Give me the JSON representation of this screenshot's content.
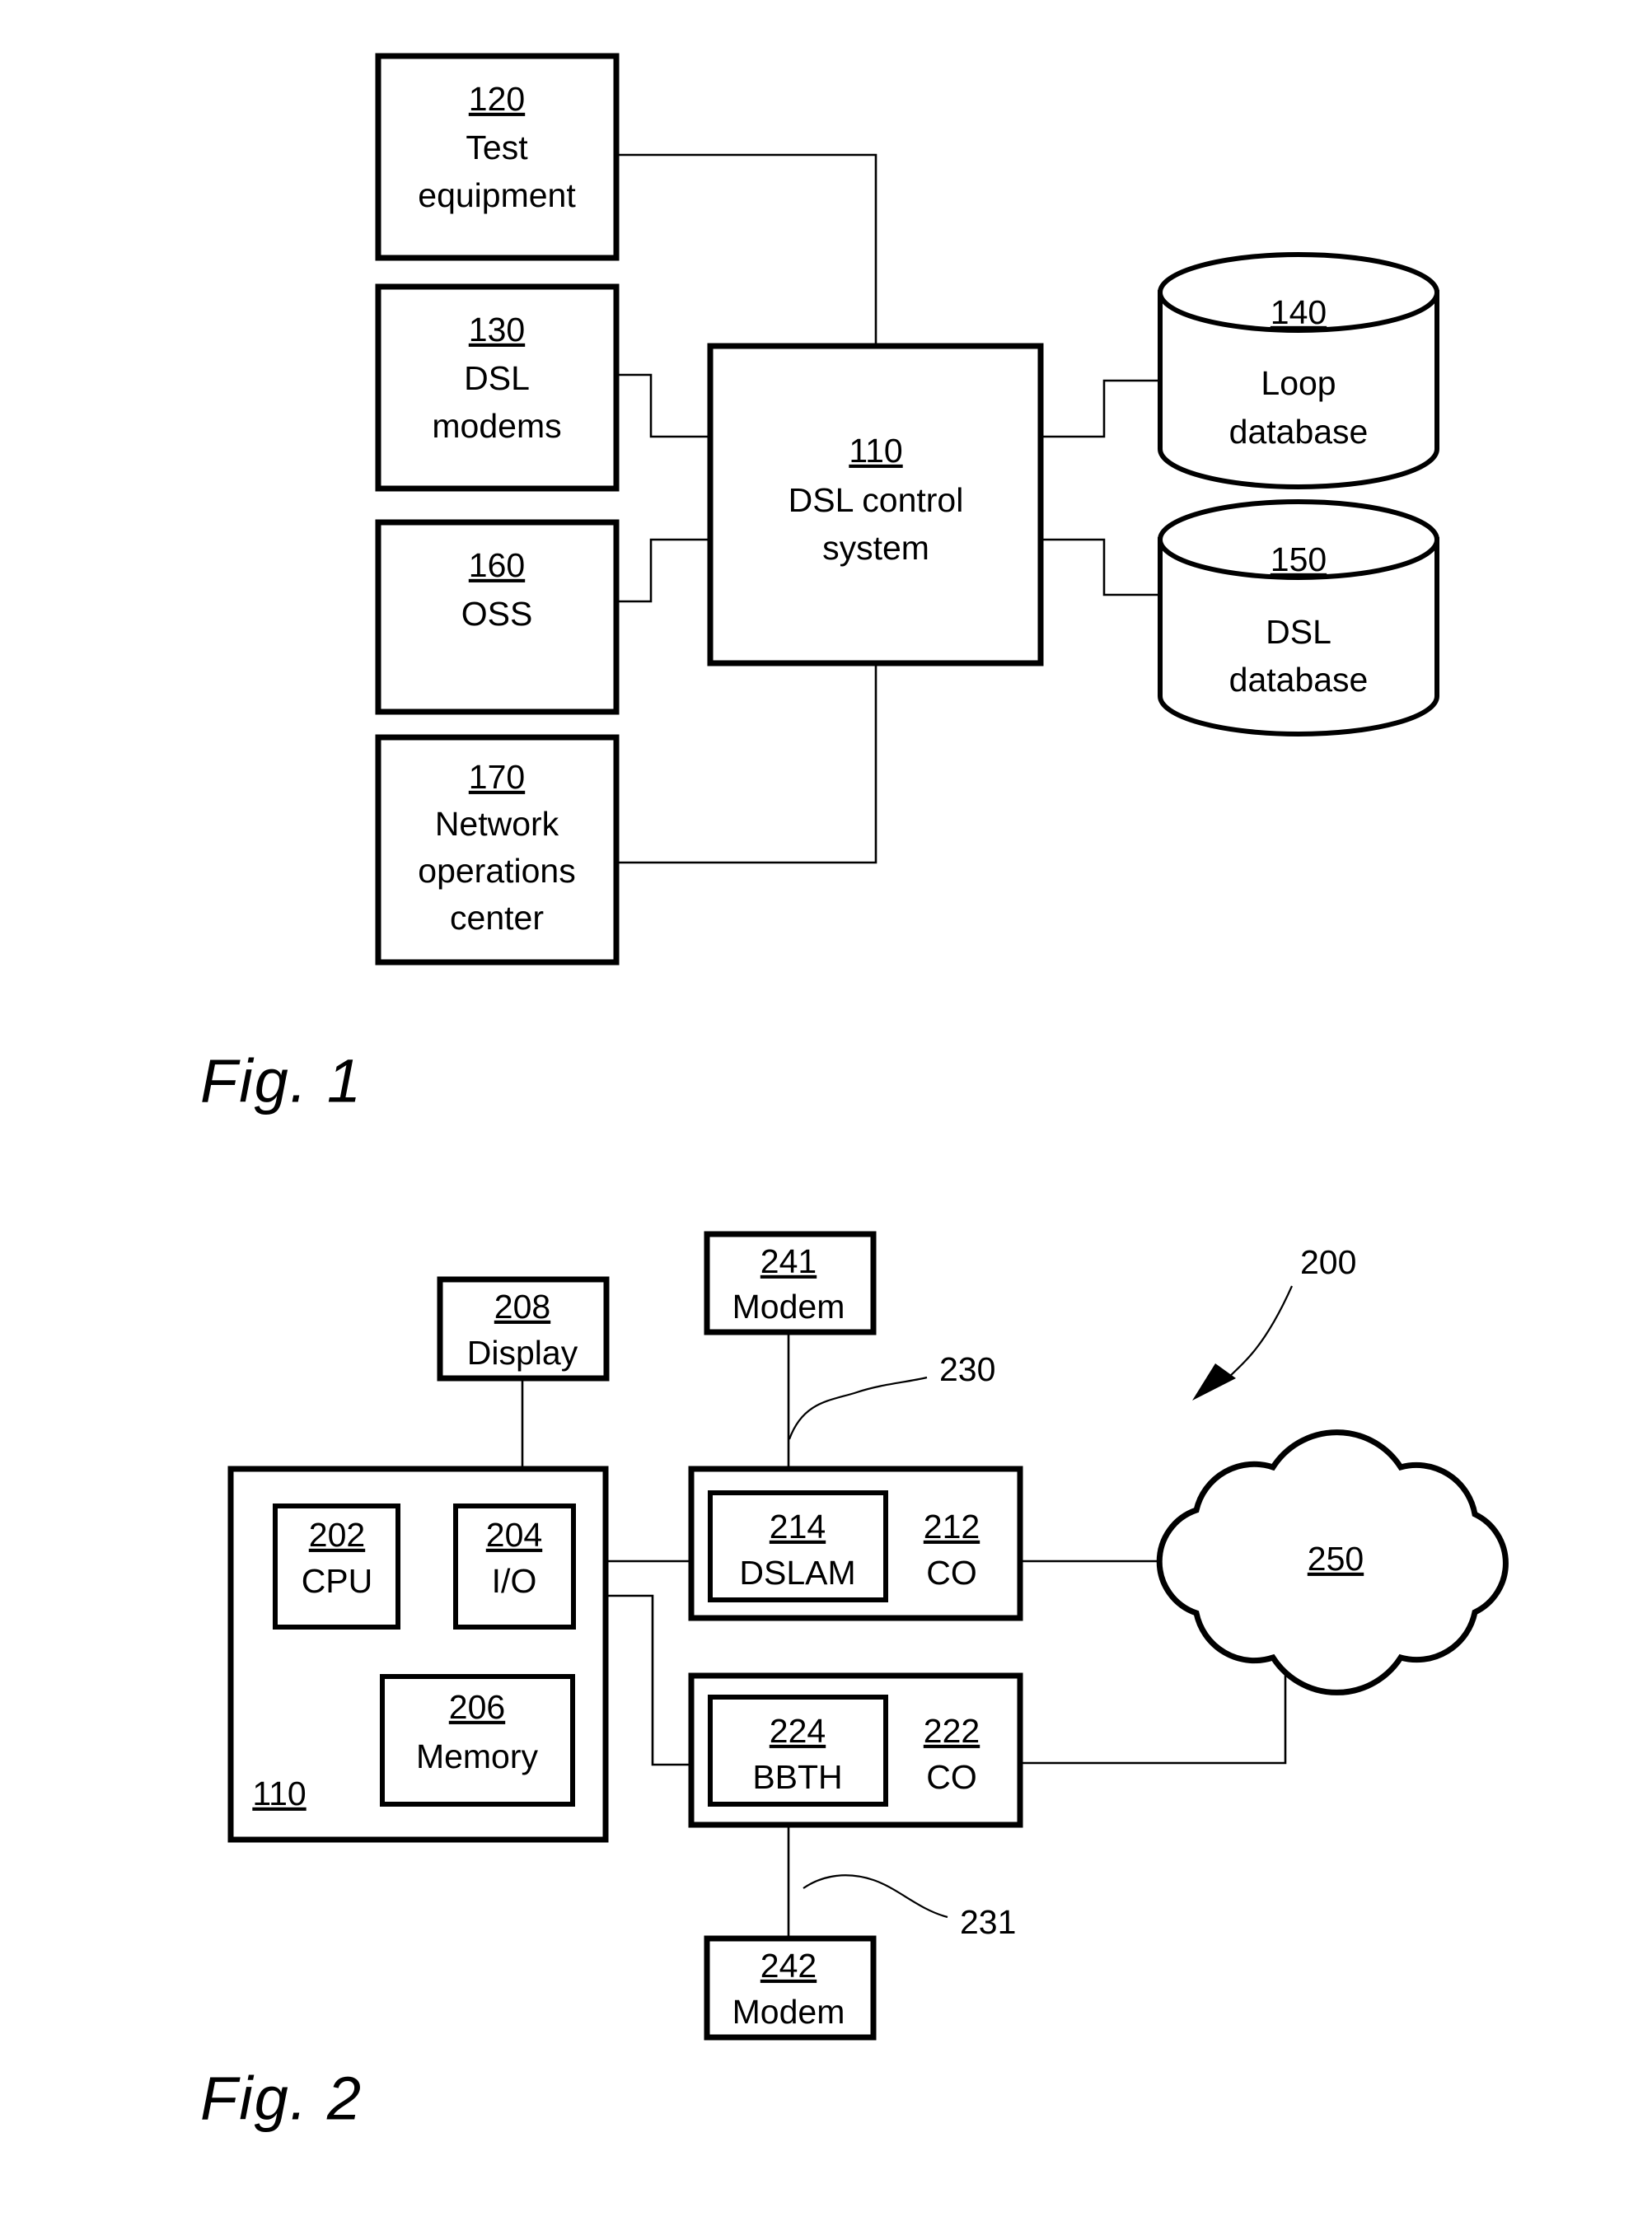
{
  "figure1": {
    "caption": "Fig. 1",
    "blocks": [
      {
        "ref": "120",
        "line1": "Test",
        "line2": "equipment"
      },
      {
        "ref": "130",
        "line1": "DSL",
        "line2": "modems"
      },
      {
        "ref": "160",
        "line1": "OSS",
        "line2": ""
      },
      {
        "ref": "170",
        "line1": "Network",
        "line2": "operations",
        "line3": "center"
      },
      {
        "ref": "110",
        "line1": "DSL control",
        "line2": "system"
      }
    ],
    "databases": [
      {
        "ref": "140",
        "line1": "Loop",
        "line2": "database"
      },
      {
        "ref": "150",
        "line1": "DSL",
        "line2": "database"
      }
    ]
  },
  "figure2": {
    "caption": "Fig. 2",
    "system_ref": "200",
    "blocks": [
      {
        "ref": "208",
        "label": "Display"
      },
      {
        "ref": "241",
        "label": "Modem"
      },
      {
        "ref": "242",
        "label": "Modem"
      },
      {
        "ref": "202",
        "label": "CPU"
      },
      {
        "ref": "204",
        "label": "I/O"
      },
      {
        "ref": "206",
        "label": "Memory"
      },
      {
        "ref": "214",
        "label": "DSLAM"
      },
      {
        "ref": "212",
        "label": "CO"
      },
      {
        "ref": "224",
        "label": "BBTH"
      },
      {
        "ref": "222",
        "label": "CO"
      }
    ],
    "container_ref": "110",
    "cloud_ref": "250",
    "loop_labels": [
      {
        "ref": "230"
      },
      {
        "ref": "231"
      }
    ]
  }
}
